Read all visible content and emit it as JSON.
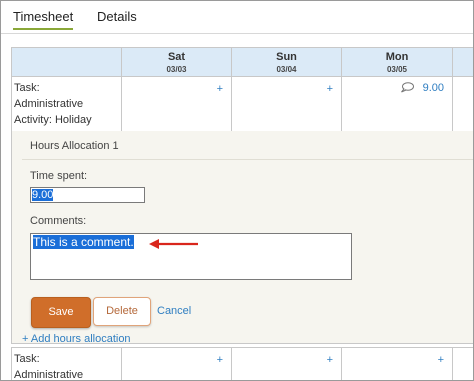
{
  "tabs": [
    {
      "label": "Timesheet",
      "active": true
    },
    {
      "label": "Details",
      "active": false
    }
  ],
  "days": [
    {
      "day": "Sat",
      "date": "03/03"
    },
    {
      "day": "Sun",
      "date": "03/04"
    },
    {
      "day": "Mon",
      "date": "03/05"
    }
  ],
  "rows": [
    {
      "task_lines": [
        "Task:",
        "Administrative",
        "Activity: Holiday"
      ],
      "cells": [
        {
          "add": "+"
        },
        {
          "add": "+"
        },
        {
          "value": "9.00",
          "icon": "comment-icon"
        }
      ]
    },
    {
      "task_lines": [
        "Task:",
        "Administrative"
      ],
      "cells": [
        {
          "add": "+"
        },
        {
          "add": "+"
        },
        {
          "add": "+"
        }
      ]
    }
  ],
  "allocation": {
    "title": "Hours Allocation 1",
    "time_label": "Time spent:",
    "time_value": "9.00",
    "comments_label": "Comments:",
    "comments_value": "This is a comment.",
    "save_label": "Save",
    "delete_label": "Delete",
    "cancel_label": "Cancel",
    "add_label": "+ Add hours allocation"
  },
  "colors": {
    "header_bg": "#dbeaf7",
    "panel_bg": "#f6f5ef",
    "save_bg": "#d06e2a",
    "link": "#2f7ec1",
    "selection": "#1a6ed8",
    "arrow": "#d9261c"
  }
}
